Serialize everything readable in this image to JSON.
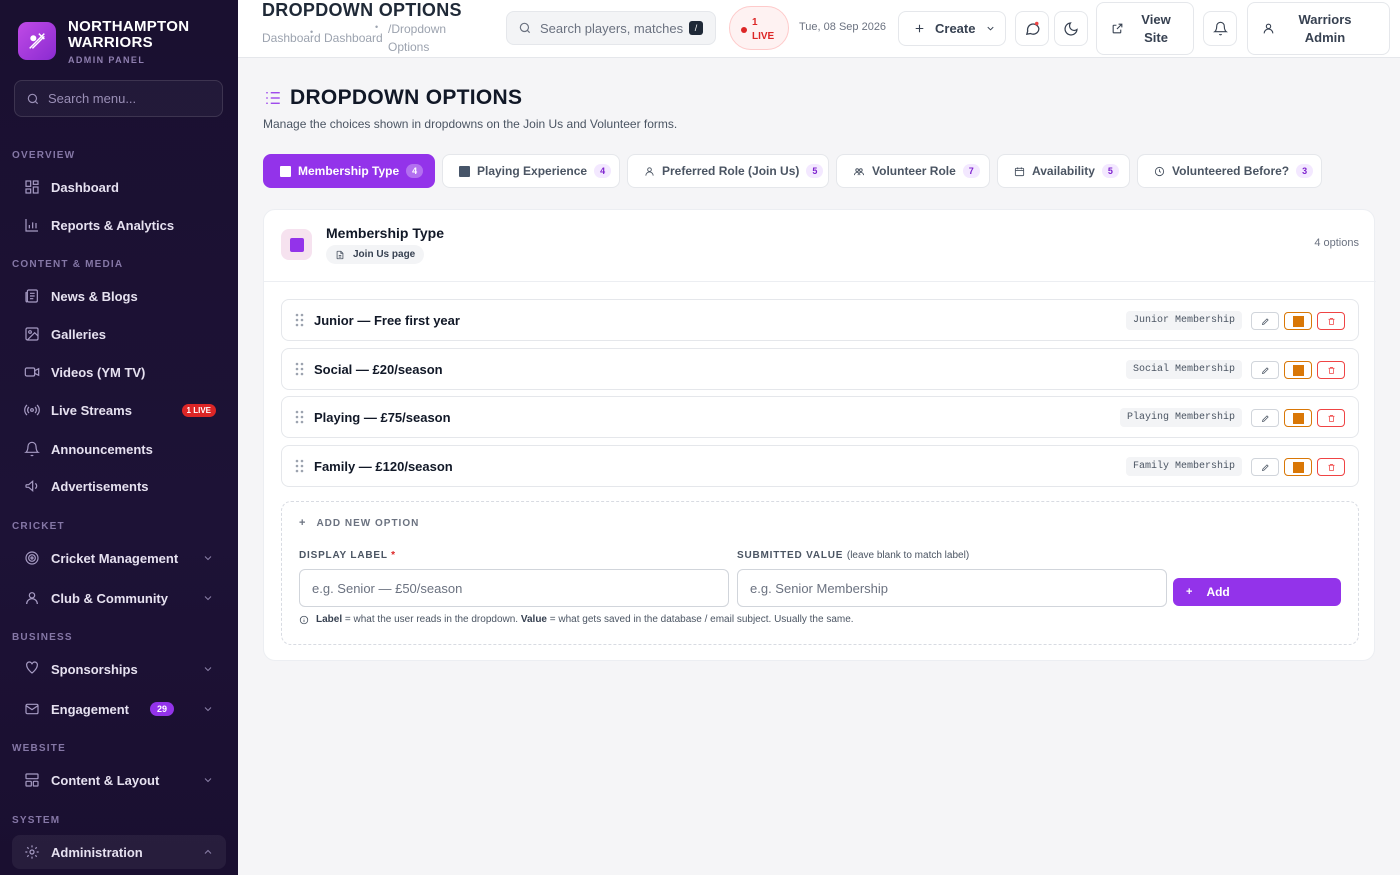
{
  "brand": {
    "name_line1": "NORTHAMPTON",
    "name_line2": "WARRIORS",
    "subtitle": "ADMIN PANEL"
  },
  "sidebar": {
    "search_placeholder": "Search menu...",
    "sections": {
      "overview": "OVERVIEW",
      "content": "CONTENT & MEDIA",
      "cricket": "CRICKET",
      "business": "BUSINESS",
      "website": "WEBSITE",
      "system": "SYSTEM"
    },
    "items": {
      "dashboard": "Dashboard",
      "reports": "Reports & Analytics",
      "news": "News & Blogs",
      "galleries": "Galleries",
      "videos": "Videos (YM TV)",
      "live_streams": "Live Streams",
      "live_streams_badge": "1 LIVE",
      "announcements": "Announcements",
      "advertisements": "Advertisements",
      "cricket_management": "Cricket Management",
      "club_community": "Club & Community",
      "sponsorships": "Sponsorships",
      "engagement": "Engagement",
      "engagement_badge": "29",
      "content_layout": "Content & Layout",
      "administration": "Administration"
    }
  },
  "topbar": {
    "title": "DROPDOWN OPTIONS",
    "breadcrumb": [
      "Dashboard",
      "Dashboard",
      "/Dropdown",
      "Options"
    ],
    "search_placeholder": "Search players, matches, r",
    "search_shortcut": "/",
    "live_count": "1",
    "live_label": "LIVE",
    "date": "Tue, 08 Sep 2026",
    "create_label": "Create",
    "view_site_line1": "View",
    "view_site_line2": "Site",
    "user_line1": "Warriors",
    "user_line2": "Admin"
  },
  "main": {
    "heading": "DROPDOWN OPTIONS",
    "description": "Manage the choices shown in dropdowns on the Join Us and Volunteer forms.",
    "tabs": [
      {
        "label": "Membership Type",
        "count": "4"
      },
      {
        "label": "Playing Experience",
        "count": "4"
      },
      {
        "label": "Preferred Role (Join Us)",
        "count": "5"
      },
      {
        "label": "Volunteer Role",
        "count": "7"
      },
      {
        "label": "Availability",
        "count": "5"
      },
      {
        "label": "Volunteered Before?",
        "count": "3"
      }
    ],
    "card": {
      "title": "Membership Type",
      "page_chip": "Join Us page",
      "option_count": "4 options",
      "options": [
        {
          "label": "Junior — Free first year",
          "value": "Junior Membership"
        },
        {
          "label": "Social — £20/season",
          "value": "Social Membership"
        },
        {
          "label": "Playing — £75/season",
          "value": "Playing Membership"
        },
        {
          "label": "Family — £120/season",
          "value": "Family Membership"
        }
      ]
    },
    "add_form": {
      "title": "ADD NEW OPTION",
      "label_field": "DISPLAY LABEL",
      "label_required": "*",
      "label_placeholder": "e.g. Senior — £50/season",
      "value_field": "SUBMITTED VALUE",
      "value_hint": "(leave blank to match label)",
      "value_placeholder": "e.g. Senior Membership",
      "add_label": "Add",
      "help_label_word": "Label",
      "help_part1": "= what the user reads in the dropdown.",
      "help_value_word": "Value",
      "help_part2": "= what gets saved in the database / email subject. Usually the same."
    }
  },
  "colors": {
    "accent": "#9333ea",
    "live": "#dc2626",
    "toggle": "#d97706",
    "sidebar_bg": "#1a1030"
  }
}
